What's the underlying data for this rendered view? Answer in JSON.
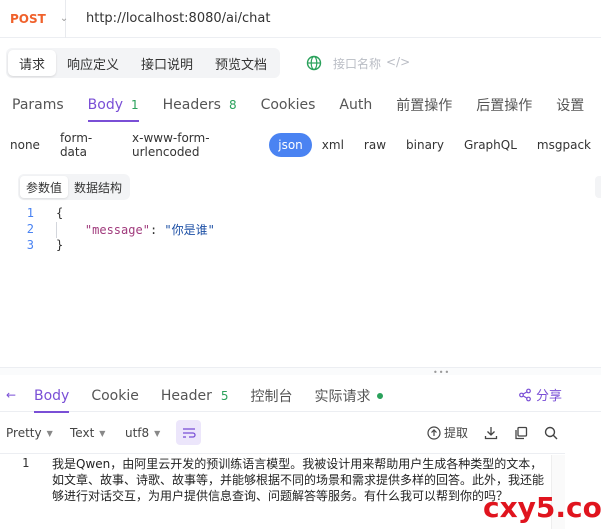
{
  "request": {
    "method": "POST",
    "url": "http://localhost:8080/ai/chat"
  },
  "doc_tabs": [
    "请求",
    "响应定义",
    "接口说明",
    "预览文档"
  ],
  "interface_name_placeholder": "接口名称",
  "request_tabs": [
    {
      "label": "Params"
    },
    {
      "label": "Body",
      "badge": "1"
    },
    {
      "label": "Headers",
      "badge": "8"
    },
    {
      "label": "Cookies"
    },
    {
      "label": "Auth"
    },
    {
      "label": "前置操作"
    },
    {
      "label": "后置操作"
    },
    {
      "label": "设置"
    }
  ],
  "body_types": [
    "none",
    "form-data",
    "x-www-form-urlencoded",
    "json",
    "xml",
    "raw",
    "binary",
    "GraphQL",
    "msgpack"
  ],
  "active_body_type": "json",
  "sub_tabs": [
    "参数值",
    "数据结构"
  ],
  "editor": {
    "line_numbers": [
      "1",
      "2",
      "3"
    ],
    "open_brace": "{",
    "key": "\"message\"",
    "colon": ": ",
    "value": "\"你是谁\"",
    "close_brace": "}"
  },
  "response_tabs": [
    {
      "label": "Body"
    },
    {
      "label": "Cookie"
    },
    {
      "label": "Header",
      "badge": "5"
    },
    {
      "label": "控制台"
    },
    {
      "label": "实际请求"
    }
  ],
  "share_label": "分享",
  "response_toolbar": {
    "format": "Pretty",
    "type": "Text",
    "encoding": "utf8",
    "extract_label": "提取"
  },
  "response_body": {
    "line_number": "1",
    "text": "我是Qwen，由阿里云开发的预训练语言模型。我被设计用来帮助用户生成各种类型的文本，如文章、故事、诗歌、故事等，并能够根据不同的场景和需求提供多样的回答。此外，我还能够进行对话交互，为用户提供信息查询、问题解答等服务。有什么我可以帮到你的吗？"
  },
  "watermark": "cxy5.com",
  "colors": {
    "accent": "#7a4fd6",
    "method": "#f0612b",
    "active_type": "#4a83f2",
    "badge": "#2aa15b",
    "watermark": "#e0141e"
  }
}
